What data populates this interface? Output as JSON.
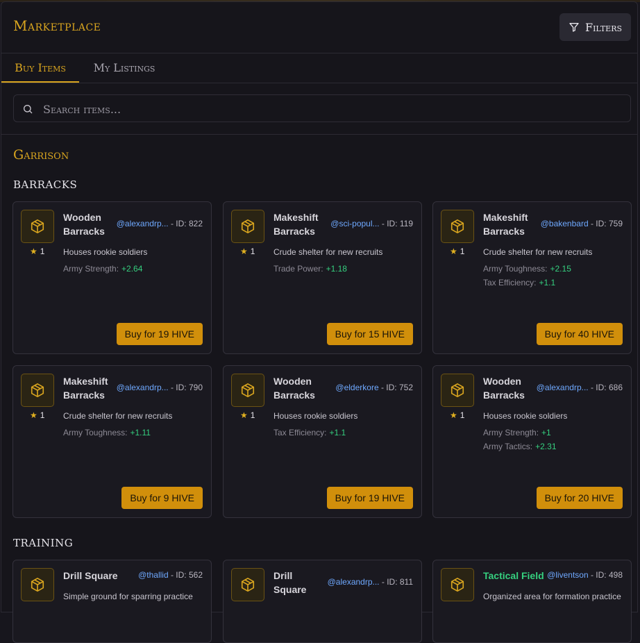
{
  "header": {
    "title": "Marketplace",
    "filters_label": "Filters"
  },
  "tabs": [
    {
      "label": "Buy Items"
    },
    {
      "label": "My Listings"
    }
  ],
  "search": {
    "placeholder": "Search items..."
  },
  "category": "Garrison",
  "sections": [
    {
      "title": "BARRACKS",
      "items": [
        {
          "name": "Wooden Barracks",
          "user": "@alexandrp...",
          "id": "- ID: 822",
          "rank": "1",
          "desc": "Houses rookie soldiers",
          "stats": [
            {
              "label": "Army Strength:",
              "value": "+2.64"
            }
          ],
          "buy": "Buy for 19 HIVE"
        },
        {
          "name": "Makeshift Barracks",
          "user": "@sci-popul...",
          "id": "- ID: 119",
          "rank": "1",
          "desc": "Crude shelter for new recruits",
          "stats": [
            {
              "label": "Trade Power:",
              "value": "+1.18"
            }
          ],
          "buy": "Buy for 15 HIVE"
        },
        {
          "name": "Makeshift Barracks",
          "user": "@bakenbard",
          "id": "- ID: 759",
          "rank": "1",
          "desc": "Crude shelter for new recruits",
          "stats": [
            {
              "label": "Army Toughness:",
              "value": "+2.15"
            },
            {
              "label": "Tax Efficiency:",
              "value": "+1.1"
            }
          ],
          "buy": "Buy for 40 HIVE"
        },
        {
          "name": "Makeshift Barracks",
          "user": "@alexandrp...",
          "id": "- ID: 790",
          "rank": "1",
          "desc": "Crude shelter for new recruits",
          "stats": [
            {
              "label": "Army Toughness:",
              "value": "+1.11"
            }
          ],
          "buy": "Buy for 9 HIVE"
        },
        {
          "name": "Wooden Barracks",
          "user": "@elderkore",
          "id": "- ID: 752",
          "rank": "1",
          "desc": "Houses rookie soldiers",
          "stats": [
            {
              "label": "Tax Efficiency:",
              "value": "+1.1"
            }
          ],
          "buy": "Buy for 19 HIVE"
        },
        {
          "name": "Wooden Barracks",
          "user": "@alexandrp...",
          "id": "- ID: 686",
          "rank": "1",
          "desc": "Houses rookie soldiers",
          "stats": [
            {
              "label": "Army Strength:",
              "value": "+1"
            },
            {
              "label": "Army Tactics:",
              "value": "+2.31"
            }
          ],
          "buy": "Buy for 20 HIVE"
        }
      ]
    },
    {
      "title": "TRAINING",
      "items": [
        {
          "name": "Drill Square",
          "user": "@thallid",
          "id": "- ID: 562",
          "desc": "Simple ground for sparring practice"
        },
        {
          "name": "Drill Square",
          "user": "@alexandrp...",
          "id": "- ID: 811"
        },
        {
          "name": "Tactical Field",
          "user": "@liventson",
          "id": "- ID: 498",
          "desc": "Organized area for formation practice"
        }
      ]
    }
  ],
  "colors": {
    "accent": "#d9a51f",
    "button": "#d18f0b",
    "stat_positive": "#35d07f",
    "username": "#6fa9ff"
  },
  "icons": {
    "filters": "filter-icon",
    "search": "search-icon",
    "item": "box-icon",
    "rank": "star-icon"
  }
}
